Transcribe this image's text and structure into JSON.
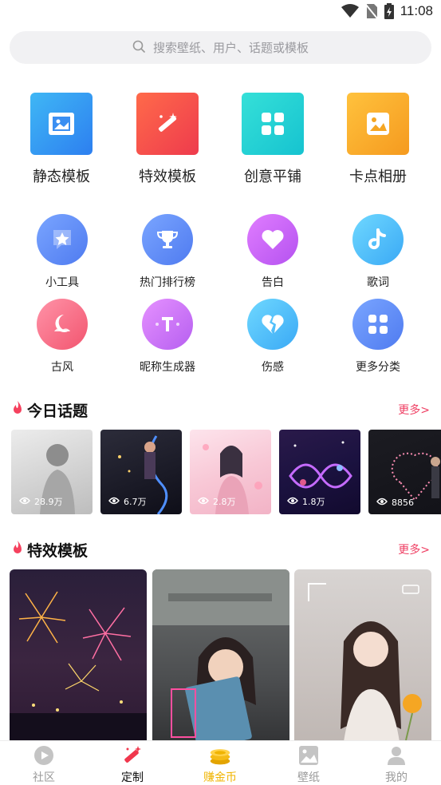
{
  "status_bar": {
    "time": "11:08"
  },
  "search": {
    "placeholder": "搜索壁纸、用户、话题或模板"
  },
  "big_templates": [
    {
      "label": "静态模板",
      "icon": "image-frame-icon"
    },
    {
      "label": "特效模板",
      "icon": "magic-wand-icon"
    },
    {
      "label": "创意平铺",
      "icon": "grid-tiles-icon"
    },
    {
      "label": "卡点相册",
      "icon": "photo-album-icon"
    }
  ],
  "categories": [
    {
      "label": "小工具",
      "icon": "star-icon"
    },
    {
      "label": "热门排行榜",
      "icon": "trophy-icon"
    },
    {
      "label": "告白",
      "icon": "heart-icon"
    },
    {
      "label": "歌词",
      "icon": "music-note-icon"
    },
    {
      "label": "古风",
      "icon": "cloud-icon"
    },
    {
      "label": "昵称生成器",
      "icon": "text-t-icon"
    },
    {
      "label": "伤感",
      "icon": "broken-heart-icon"
    },
    {
      "label": "更多分类",
      "icon": "apps-icon"
    }
  ],
  "topics_section": {
    "title": "今日话题",
    "more": "更多>",
    "items": [
      {
        "views": "28.9万"
      },
      {
        "views": "6.7万"
      },
      {
        "views": "2.8万"
      },
      {
        "views": "1.8万"
      },
      {
        "views": "8856"
      }
    ]
  },
  "templates_section": {
    "title": "特效模板",
    "more": "更多>"
  },
  "bottom_nav": [
    {
      "label": "社区",
      "icon": "play-circle-icon"
    },
    {
      "label": "定制",
      "icon": "magic-wand-icon"
    },
    {
      "label": "赚金币",
      "icon": "coin-stack-icon"
    },
    {
      "label": "壁纸",
      "icon": "picture-icon"
    },
    {
      "label": "我的",
      "icon": "user-icon"
    }
  ],
  "colors": {
    "accent": "#ef3f63",
    "gold": "#f0b400",
    "tile_blue": "#2f8ff0",
    "tile_red": "#f0474a",
    "tile_cyan": "#1fd0d0",
    "tile_orange": "#f5a623"
  }
}
